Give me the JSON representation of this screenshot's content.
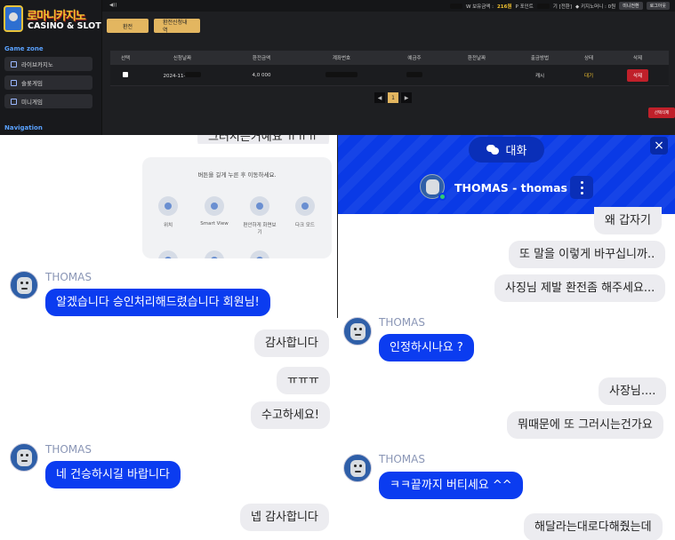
{
  "site": {
    "logo_title": "로마니카지노",
    "logo_sub": "CASINO & SLOT",
    "topbar": {
      "left_text": "◀))",
      "balance_label": "W 보유금액 :",
      "balance_value": "216원",
      "point_label": "P 포인트",
      "point_rest": "기 [전환]",
      "kiji_label": "◆ 키지노머니 : 0원",
      "minigame_btn": "미니전환",
      "logout_btn": "로그아웃"
    },
    "sidebar": {
      "gamezone_heading": "Game zone",
      "items": [
        {
          "label": "라이브카지노"
        },
        {
          "label": "슬롯게임"
        },
        {
          "label": "미니게임"
        }
      ],
      "navigation_heading": "Navigation"
    },
    "tabs": [
      {
        "label": "환전"
      },
      {
        "label": "환전신청내역"
      }
    ],
    "table": {
      "headers": [
        "선택",
        "신청날짜",
        "환전금액",
        "계좌번호",
        "예금주",
        "환전날짜",
        "출금방법",
        "상태",
        "삭제"
      ],
      "row": {
        "date": "2024-11-",
        "amount": "4,0 000",
        "account": "",
        "holder": "",
        "exchange_date": "",
        "method": "캐시",
        "status": "대기",
        "delete": "삭제"
      }
    },
    "pager": {
      "prev": "◀",
      "current": "1",
      "next": "▶"
    },
    "bulk_delete": "선택삭제"
  },
  "left_chat": {
    "clipped_text": "그러시는거예요 ㅠㅠㅠ",
    "screenshot": {
      "message": "버튼을 길게 누른 후 이동하세요.",
      "items": [
        {
          "label": "위치"
        },
        {
          "label": "Smart View"
        },
        {
          "label": "편안하게 화면보기"
        },
        {
          "label": "다크 모드"
        }
      ]
    },
    "messages": [
      {
        "sender": "THOMAS",
        "text": "알겠습니다 승인처리해드렸습니다 회원님!"
      },
      {
        "text": "감사합니다"
      },
      {
        "text": "ㅠㅠㅠ"
      },
      {
        "text": "수고하세요!"
      },
      {
        "sender": "THOMAS",
        "text": "네 건승하시길 바랍니다"
      },
      {
        "text": "넵 감사합니다"
      }
    ]
  },
  "right_chat": {
    "tab_label": "대화",
    "close": "×",
    "title": "THOMAS - thomas",
    "messages": [
      {
        "text": "왜 갑자기"
      },
      {
        "text": "또 말을 이렇게 바꾸십니까.."
      },
      {
        "text": "사징님 제발 환전좀 해주세요..."
      },
      {
        "sender": "THOMAS",
        "text": "인정하시나요 ?"
      },
      {
        "text": "사장님...."
      },
      {
        "text": "뭐때문에 또 그러시는건가요"
      },
      {
        "sender": "THOMAS",
        "text": "ㅋㅋ끝까지 버티세요 ^^"
      },
      {
        "text": "해달라는대로다해줬는데"
      }
    ]
  },
  "colors": {
    "user_bubble": "#ececf0",
    "agent_bubble": "#0b3cf0",
    "header_blue": "#0a3ae6",
    "accent_gold": "#e3b660",
    "danger_red": "#c0202a"
  }
}
